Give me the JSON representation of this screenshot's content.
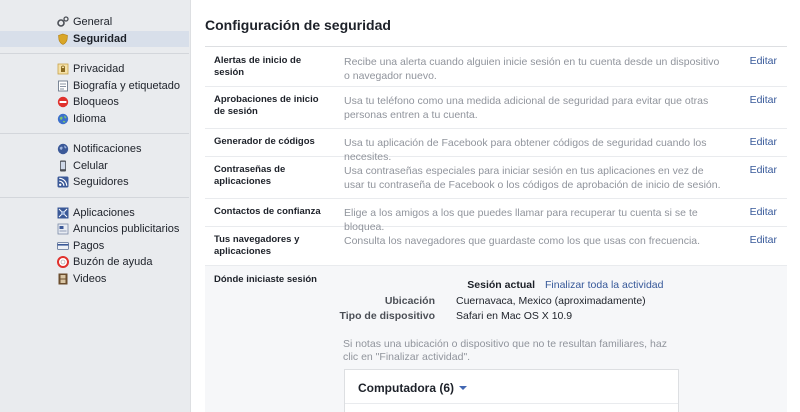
{
  "sidebar": {
    "groups": [
      {
        "items": [
          {
            "label": "General",
            "icon": "gear-icon",
            "active": false
          },
          {
            "label": "Seguridad",
            "icon": "shield-icon",
            "active": true
          }
        ]
      },
      {
        "items": [
          {
            "label": "Privacidad",
            "icon": "privacy-lock-icon"
          },
          {
            "label": "Biografía y etiquetado",
            "icon": "timeline-icon"
          },
          {
            "label": "Bloqueos",
            "icon": "block-icon"
          },
          {
            "label": "Idioma",
            "icon": "globe-icon"
          }
        ]
      },
      {
        "items": [
          {
            "label": "Notificaciones",
            "icon": "globe-notifications-icon"
          },
          {
            "label": "Celular",
            "icon": "mobile-icon"
          },
          {
            "label": "Seguidores",
            "icon": "rss-icon"
          }
        ]
      },
      {
        "items": [
          {
            "label": "Aplicaciones",
            "icon": "apps-icon"
          },
          {
            "label": "Anuncios publicitarios",
            "icon": "ads-icon"
          },
          {
            "label": "Pagos",
            "icon": "payments-icon"
          },
          {
            "label": "Buzón de ayuda",
            "icon": "lifebuoy-icon"
          },
          {
            "label": "Videos",
            "icon": "film-icon"
          }
        ]
      }
    ]
  },
  "main": {
    "title": "Configuración de seguridad",
    "edit_label": "Editar",
    "rows": [
      {
        "label": "Alertas de inicio de sesión",
        "desc": "Recibe una alerta cuando alguien inicie sesión en tu cuenta desde un dispositivo o navegador nuevo."
      },
      {
        "label": "Aprobaciones de inicio de sesión",
        "desc": "Usa tu teléfono como una medida adicional de seguridad para evitar que otras personas entren a tu cuenta."
      },
      {
        "label": "Generador de códigos",
        "desc": "Usa tu aplicación de Facebook para obtener códigos de seguridad cuando los necesites."
      },
      {
        "label": "Contraseñas de aplicaciones",
        "desc": "Usa contraseñas especiales para iniciar sesión en tus aplicaciones en vez de usar tu contraseña de Facebook o los códigos de aprobación de inicio de sesión."
      },
      {
        "label": "Contactos de confianza",
        "desc": "Elige a los amigos a los que puedes llamar para recuperar tu cuenta si se te bloquea."
      },
      {
        "label": "Tus navegadores y aplicaciones",
        "desc": "Consulta los navegadores que guardaste como los que usas con frecuencia."
      }
    ],
    "sessions": {
      "title": "Dónde iniciaste sesión",
      "current_label": "Sesión actual",
      "finalize_all": "Finalizar toda la actividad",
      "location_label": "Ubicación",
      "location_value": "Cuernavaca, Mexico (aproximadamente)",
      "device_label": "Tipo de dispositivo",
      "device_value": "Safari en Mac OS X 10.9",
      "notice": "Si notas una ubicación o dispositivo que no te resultan familiares, haz clic en \"Finalizar actividad\".",
      "devices_header": "Computadora (6)"
    }
  },
  "colors": {
    "link": "#365899",
    "active_nav": "#d8dfea",
    "muted_text": "#90949c"
  }
}
